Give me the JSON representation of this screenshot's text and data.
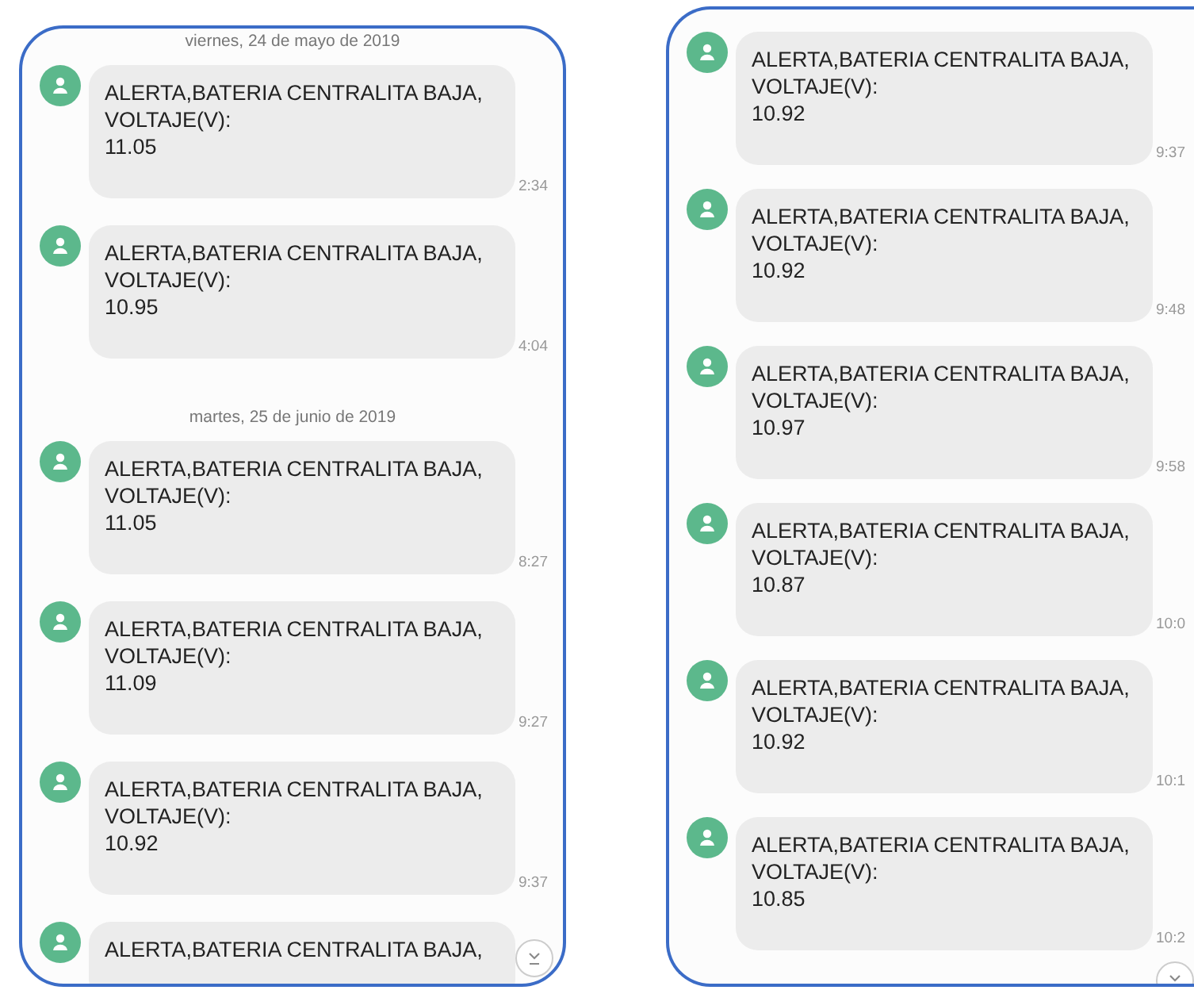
{
  "panels": [
    {
      "items": [
        {
          "kind": "date",
          "text": "viernes, 24 de mayo de 2019"
        },
        {
          "kind": "message",
          "text": "ALERTA,BATERIA CENTRALITA BAJA,\nVOLTAJE(V):\n11.05",
          "time": "2:34"
        },
        {
          "kind": "message",
          "text": "ALERTA,BATERIA CENTRALITA BAJA,\nVOLTAJE(V):\n10.95",
          "time": "4:04"
        },
        {
          "kind": "date",
          "text": "martes, 25 de junio de 2019"
        },
        {
          "kind": "message",
          "text": "ALERTA,BATERIA CENTRALITA BAJA,\nVOLTAJE(V):\n11.05",
          "time": "8:27"
        },
        {
          "kind": "message",
          "text": "ALERTA,BATERIA CENTRALITA BAJA,\nVOLTAJE(V):\n11.09",
          "time": "9:27"
        },
        {
          "kind": "message",
          "text": "ALERTA,BATERIA CENTRALITA BAJA,\nVOLTAJE(V):\n10.92",
          "time": "9:37"
        },
        {
          "kind": "message",
          "text": "ALERTA,BATERIA CENTRALITA BAJA,"
        }
      ]
    },
    {
      "items": [
        {
          "kind": "message",
          "text": "ALERTA,BATERIA CENTRALITA BAJA,\nVOLTAJE(V):\n10.92",
          "time": "9:37"
        },
        {
          "kind": "message",
          "text": "ALERTA,BATERIA CENTRALITA BAJA,\nVOLTAJE(V):\n10.92",
          "time": "9:48"
        },
        {
          "kind": "message",
          "text": "ALERTA,BATERIA CENTRALITA BAJA,\nVOLTAJE(V):\n10.97",
          "time": "9:58"
        },
        {
          "kind": "message",
          "text": "ALERTA,BATERIA CENTRALITA BAJA,\nVOLTAJE(V):\n10.87",
          "time": "10:0"
        },
        {
          "kind": "message",
          "text": "ALERTA,BATERIA CENTRALITA BAJA,\nVOLTAJE(V):\n10.92",
          "time": "10:1"
        },
        {
          "kind": "message",
          "text": "ALERTA,BATERIA CENTRALITA BAJA,\nVOLTAJE(V):\n10.85",
          "time": "10:2"
        }
      ]
    }
  ]
}
